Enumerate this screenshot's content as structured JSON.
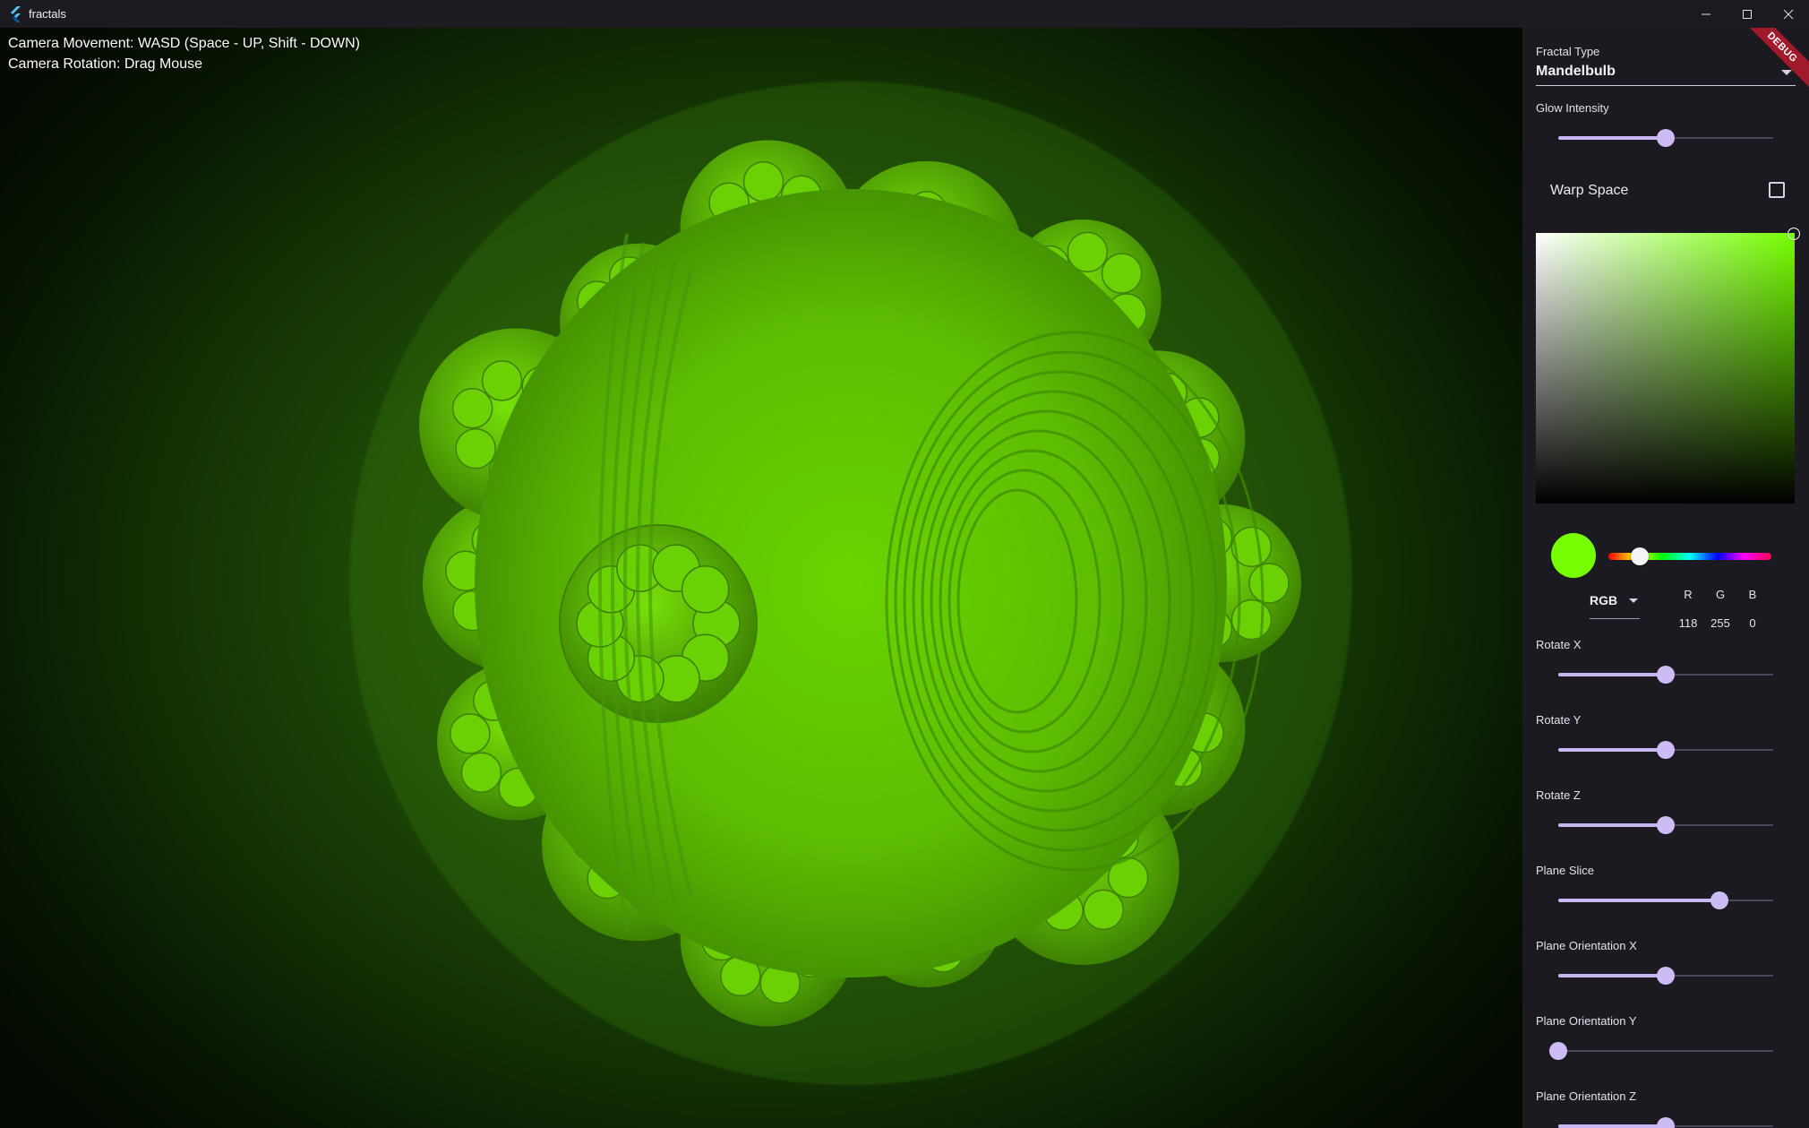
{
  "window": {
    "title": "fractals",
    "icons": [
      "flutter-logo",
      "minimize-icon",
      "maximize-icon",
      "close-icon"
    ]
  },
  "viewport": {
    "help_movement": "Camera Movement: WASD (Space - UP, Shift - DOWN)",
    "help_rotation": "Camera Rotation: Drag Mouse",
    "fractal_color": "#76ff00"
  },
  "sidebar": {
    "debug_banner": "DEBUG",
    "fractal_type": {
      "label": "Fractal Type",
      "value": "Mandelbulb"
    },
    "glow_intensity": {
      "label": "Glow Intensity",
      "value": 0.5
    },
    "warp_space": {
      "label": "Warp Space",
      "checked": false
    },
    "color_picker": {
      "mode": "RGB",
      "channels": [
        {
          "name": "R",
          "value": "118"
        },
        {
          "name": "G",
          "value": "255"
        },
        {
          "name": "B",
          "value": "0"
        }
      ],
      "hue": 0.19,
      "hex": "#76ff00"
    },
    "sliders": [
      {
        "label": "Rotate X",
        "value": 0.5
      },
      {
        "label": "Rotate Y",
        "value": 0.5
      },
      {
        "label": "Rotate Z",
        "value": 0.5
      },
      {
        "label": "Plane Slice",
        "value": 0.75
      },
      {
        "label": "Plane Orientation X",
        "value": 0.5
      },
      {
        "label": "Plane Orientation Y",
        "value": 0.0
      },
      {
        "label": "Plane Orientation Z",
        "value": 0.5
      }
    ]
  }
}
